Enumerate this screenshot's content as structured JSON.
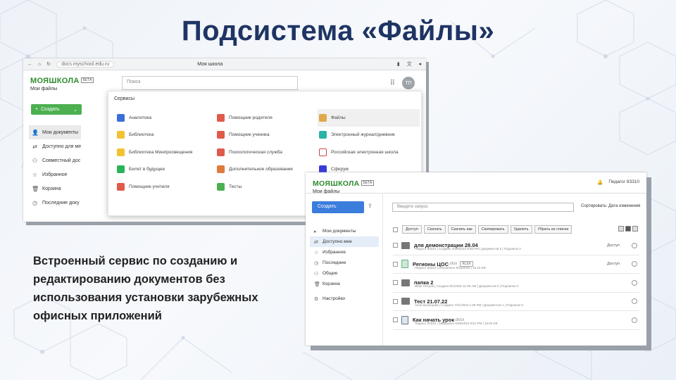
{
  "title": "Подсистема «Файлы»",
  "caption": "Встроенный сервис по созданию и редактированию документов без использования установки зарубежных офисных приложений",
  "colors": {
    "title": "#1e3464",
    "brand_green": "#2e8b2e",
    "create_green": "#4caf50",
    "create_blue": "#3b7ddd"
  },
  "screenshot1": {
    "url": "docs.myschool.edu.ru",
    "tab_title": "Моя школа",
    "brand": "МОЯШКОЛА",
    "beta": "БЕТА",
    "sub_brand": "Мои файлы",
    "search_placeholder": "Поиск",
    "avatar": "ТП",
    "create_label": "Создать",
    "nav": [
      {
        "icon": "person-icon",
        "label": "Мои документы"
      },
      {
        "icon": "share-icon",
        "label": "Доступно для ме"
      },
      {
        "icon": "group-icon",
        "label": "Совместный дос"
      },
      {
        "icon": "star-icon",
        "label": "Избранное"
      },
      {
        "icon": "trash-icon",
        "label": "Корзина"
      },
      {
        "icon": "clock-icon",
        "label": "Последние доку"
      }
    ],
    "services_header": "Сервисы",
    "services": [
      {
        "label": "Аналитика",
        "color": "#3a6fd8"
      },
      {
        "label": "Помощник родителя",
        "color": "#e05a4a"
      },
      {
        "label": "Файлы",
        "color": "#e0a84a"
      },
      {
        "label": "Библиотека",
        "color": "#f2c230"
      },
      {
        "label": "Помощник ученика",
        "color": "#e05a4a"
      },
      {
        "label": "Электронный журнал/дневник",
        "color": "#2bb3a8"
      },
      {
        "label": "Библиотека Минпросвещения",
        "color": "#f2c230"
      },
      {
        "label": "Психологическая служба",
        "color": "#e05a4a"
      },
      {
        "label": "Российская электронная школа",
        "color": "#ffffff"
      },
      {
        "label": "Билет в будущее",
        "color": "#2bb35a"
      },
      {
        "label": "Дополнительное образование",
        "color": "#e07a3a"
      },
      {
        "label": "Сферум",
        "color": "#3a3ad8"
      },
      {
        "label": "Помощник учителя",
        "color": "#e05a4a"
      },
      {
        "label": "Тесты",
        "color": "#4caf50"
      }
    ]
  },
  "screenshot2": {
    "brand": "МОЯШКОЛА",
    "beta": "БЕТА",
    "sub_brand": "Мои файлы",
    "user": "Педагог 83310",
    "create_label": "Создать",
    "nav": [
      {
        "icon": "folder-icon",
        "label": "Мои документы"
      },
      {
        "icon": "share-icon",
        "label": "Доступно мне"
      },
      {
        "icon": "star-icon",
        "label": "Избранное"
      },
      {
        "icon": "clock-icon",
        "label": "Последние"
      },
      {
        "icon": "group-icon",
        "label": "Общие"
      },
      {
        "icon": "trash-icon",
        "label": "Корзина"
      },
      {
        "icon": "gear-icon",
        "label": "Настройки"
      }
    ],
    "search_placeholder": "Введите запрос",
    "sort_label": "Сортировать: Дата изменения",
    "actions": [
      "Доступ",
      "Скачать",
      "Скачать как",
      "Скопировать",
      "Удалить",
      "Убрать из списка"
    ],
    "rows": [
      {
        "type": "folder",
        "name": "для демонстрации 28.04",
        "ext": "",
        "meta": "Педагог 83310 | Создано 4/28/2022 8:56 PM | Документов 5 | Подпапок 0",
        "access": "Доступ"
      },
      {
        "type": "xls",
        "name": "Регионы ЦОС",
        "ext": ".xlsx",
        "tag": "XLSX",
        "meta": "Педагог 83310 | Обновлено 9/15/2022 | 15.16 KB",
        "access": "Доступ"
      },
      {
        "type": "folder",
        "name": "папка 2",
        "ext": "",
        "meta": "Иван Петров | Создано 8/1/2022 11:08 AM | Документов 0 | Подпапок 0",
        "access": ""
      },
      {
        "type": "folder",
        "name": "Тест 21.07.22",
        "ext": "",
        "meta": "Анна Кузнецова | Создано 7/21/2022 1:39 PM | Документов 1 | Подпапок 0",
        "access": ""
      },
      {
        "type": "docx",
        "name": "Как начать урок",
        "ext": ".docx",
        "meta": "Педагог 83310 | Загружено 4/28/2022 8:51 PM | 33.63 KB",
        "access": ""
      }
    ]
  }
}
